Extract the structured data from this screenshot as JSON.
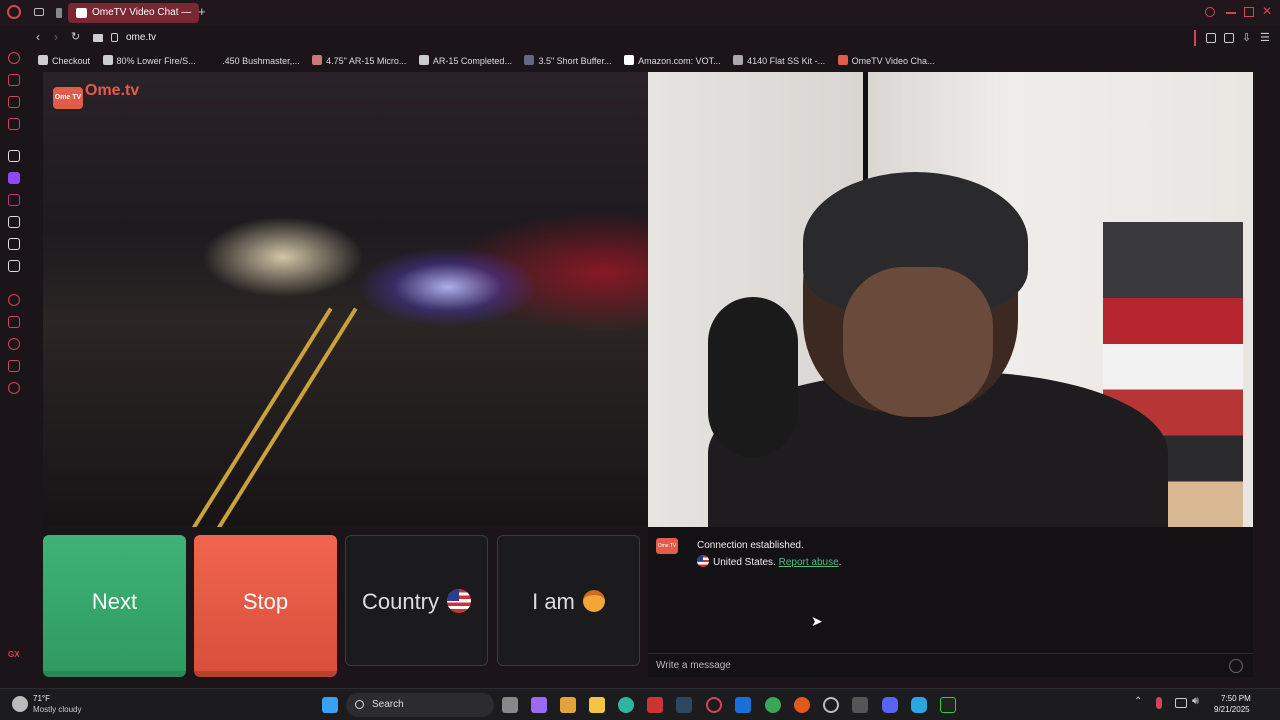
{
  "browser": {
    "tab_title": "OmeTV Video Chat —",
    "new_tab_symbol": "+",
    "url": "ome.tv",
    "bookmarks": [
      {
        "label": "Checkout"
      },
      {
        "label": "80% Lower Fire/S..."
      },
      {
        "label": ".450 Bushmaster,..."
      },
      {
        "label": "4.75\" AR-15 Micro..."
      },
      {
        "label": "AR-15 Completed..."
      },
      {
        "label": "3.5\" Short Buffer..."
      },
      {
        "label": "Amazon.com: VOT..."
      },
      {
        "label": "4140 Flat SS Kit -..."
      },
      {
        "label": "OmeTV Video Cha..."
      }
    ],
    "sidebar_label": "GX"
  },
  "page": {
    "logo_box": "Ome TV",
    "logo_text": "Ome.tv",
    "buttons": {
      "next": "Next",
      "stop": "Stop",
      "country": "Country",
      "iam": "I am"
    },
    "chat": {
      "logo": "Ome TV",
      "status": "Connection established.",
      "country": "United States.",
      "report_link": "Report abuse",
      "report_suffix": ".",
      "placeholder": "Write a message"
    }
  },
  "taskbar": {
    "weather_temp": "71°F",
    "weather_desc": "Mostly cloudy",
    "search_label": "Search",
    "time": "7:50 PM",
    "date": "9/21/2025"
  },
  "colors": {
    "next": "#3fb277",
    "stop": "#f1654f",
    "accent": "#e35b4c",
    "link": "#4fbf7f"
  }
}
